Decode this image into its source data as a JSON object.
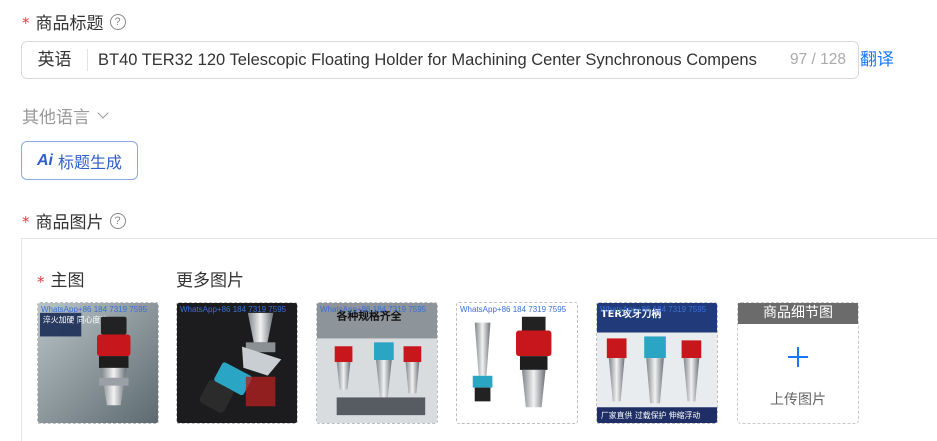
{
  "title_section": {
    "label": "商品标题",
    "help_icon": "question-circle-icon",
    "language": "英语",
    "value": "BT40 TER32 120 Telescopic Floating Holder for Machining Center Synchronous Compens",
    "counter": "97 / 128",
    "translate_link": "翻译"
  },
  "other_languages": {
    "label": "其他语言",
    "icon": "chevron-down-icon"
  },
  "ai_button": {
    "icon_text": "Ai",
    "label": "标题生成"
  },
  "images_section": {
    "label": "商品图片",
    "help_icon": "question-circle-icon",
    "main_label": "主图",
    "more_label": "更多图片",
    "thumbnails": [
      {
        "overlay": "WhatsApp+86 184 7319 7595",
        "caption": "淬火加硬 同心度高"
      },
      {
        "overlay": "WhatsApp+86 184 7319 7595",
        "caption": ""
      },
      {
        "overlay": "WhatsApp+86 184 7319 7595",
        "caption": "各种规格齐全"
      },
      {
        "overlay": "WhatsApp+86 184 7319 7595",
        "caption": ""
      },
      {
        "overlay": "WhatsApp+86 184 7319 7595",
        "caption": "TER攻牙刀柄",
        "footer": "厂家直供  过载保护 伸缩浮动"
      }
    ],
    "upload": {
      "header": "商品细节图",
      "icon": "plus-icon",
      "label": "上传图片"
    }
  },
  "colors": {
    "required": "#e4393c",
    "link": "#1677ff",
    "ai_accent": "#2f5fc8"
  }
}
